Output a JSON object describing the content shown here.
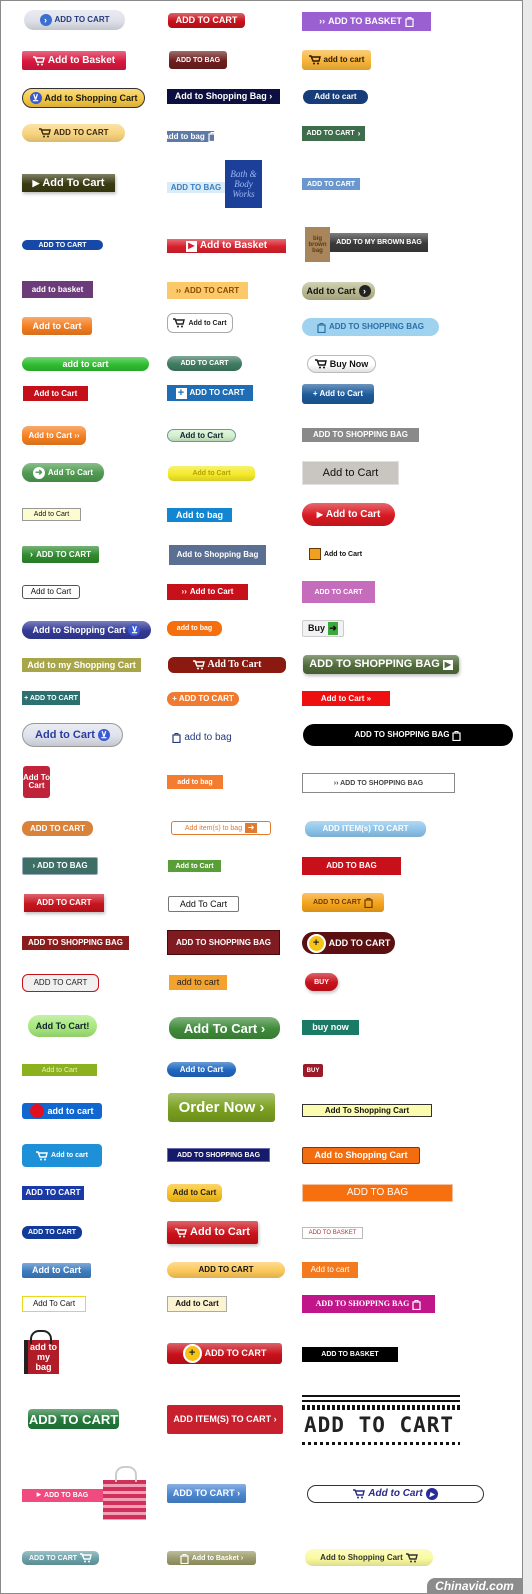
{
  "buttons": [
    {
      "label": "ADD TO CART",
      "bg": "#dfe0ea",
      "fg": "#233a7a",
      "icon": "chevron-circle",
      "icolor": "#3a6ed0"
    },
    {
      "label": "ADD TO CART",
      "bg": "#c8101a",
      "fg": "#ffffff"
    },
    {
      "label": "ADD TO BASKET",
      "bg": "#9a5fd0",
      "fg": "#ffffff",
      "icon": "double-chevron",
      "icon2": "basket"
    },
    {
      "label": "Add to Basket",
      "bg": "#d8173f",
      "fg": "#ffffff",
      "icon": "cart"
    },
    {
      "label": "ADD TO BAG",
      "bg": "#6e1e1e",
      "fg": "#ffffff"
    },
    {
      "label": "add to cart",
      "bg": "#f7b43a",
      "fg": "#2a1a00",
      "icon": "cart"
    },
    {
      "label": "Add to Shopping Cart",
      "bg": "#f5c842",
      "fg": "#1a1a1a",
      "icon": "cart-circle",
      "border": "#333333"
    },
    {
      "label": "Add to Shopping Bag ›",
      "bg": "#0c0f40",
      "fg": "#ffffff"
    },
    {
      "label": "Add to cart",
      "bg": "#163d7a",
      "fg": "#ffffff"
    },
    {
      "label": "ADD TO CART",
      "bg": "#f8d37c",
      "fg": "#3a2a10",
      "icon": "cart"
    },
    {
      "label": "add to bag",
      "bg": "#5e79a5",
      "fg": "#ffffff",
      "icon2": "bag"
    },
    {
      "label": "ADD TO CART",
      "bg": "#3d6d4a",
      "fg": "#ffffff",
      "icon2": "chevron"
    },
    {
      "label": "Add To Cart",
      "bg": "#3b3b12",
      "fg": "#ffffff",
      "icon": "play"
    },
    {
      "label": "ADD TO BAG",
      "bg": "#d9ecf8",
      "fg": "#3b7fc0"
    },
    {
      "label": "ADD TO CART",
      "bg": "#6b97cf",
      "fg": "#ffffff"
    },
    {
      "label": "ADD TO CART",
      "bg": "#1648a8",
      "fg": "#ffffff"
    },
    {
      "label": "Add to Basket",
      "bg": "#d8202c",
      "fg": "#ffffff",
      "icon": "play-box"
    },
    {
      "label": "ADD TO MY BROWN BAG",
      "bg": "#3a3a3a",
      "fg": "#ffffff"
    },
    {
      "label": "add to basket",
      "bg": "#6b3b7a",
      "fg": "#ffffff"
    },
    {
      "label": "ADD TO CART",
      "bg": "#fcc96a",
      "fg": "#8a4a00",
      "icon": "double-chevron"
    },
    {
      "label": "Add to Cart",
      "bg": "#b8b890",
      "fg": "#111111",
      "icon2": "chevron-circle",
      "icolor": "#222222"
    },
    {
      "label": "Add to Cart",
      "bg": "#f47d20",
      "fg": "#ffffff"
    },
    {
      "label": "Add to Cart",
      "bg": "#ffffff",
      "fg": "#222222",
      "icon": "cart",
      "border": "#aaaaaa"
    },
    {
      "label": "ADD TO SHOPPING BAG",
      "bg": "#9fd2ef",
      "fg": "#2a6fa8",
      "icon": "basket"
    },
    {
      "label": "add to cart",
      "bg": "#2fbd2f",
      "fg": "#ffffff"
    },
    {
      "label": "ADD TO CART",
      "bg": "#3f7a60",
      "fg": "#ffffff"
    },
    {
      "label": "Buy Now",
      "bg": "#ffffff",
      "fg": "#111111",
      "icon": "cart",
      "border": "#bbbbbb"
    },
    {
      "label": "Add to Cart",
      "bg": "#c3101a",
      "fg": "#ffffff"
    },
    {
      "label": "ADD TO CART",
      "bg": "#1f6eb5",
      "fg": "#ffffff",
      "icon": "plus-box"
    },
    {
      "label": "+ Add to Cart",
      "bg": "#1c5a9a",
      "fg": "#ffffff"
    },
    {
      "label": "Add to Cart ››",
      "bg": "#f57f1f",
      "fg": "#ffffff"
    },
    {
      "label": "Add to Cart",
      "bg": "#d2f0cc",
      "fg": "#112233",
      "border": "#6a9a9a"
    },
    {
      "label": "ADD TO SHOPPING BAG",
      "bg": "#8a8a8a",
      "fg": "#ffffff"
    },
    {
      "label": "Add To Cart",
      "bg": "#4e9a50",
      "fg": "#ffffff",
      "icon": "arrow-circle"
    },
    {
      "label": "Add to Cart",
      "bg": "#f4ea28",
      "fg": "#b7a000"
    },
    {
      "label": "Add to Cart",
      "bg": "#c9c5c0",
      "fg": "#111111",
      "border": "#e0e0e0"
    },
    {
      "label": "Add to Cart",
      "bg": "#fdfbd0",
      "fg": "#111111",
      "border": "#999999"
    },
    {
      "label": "Add to bag",
      "bg": "#1286d0",
      "fg": "#ffffff"
    },
    {
      "label": "Add to Cart",
      "bg": "#d81820",
      "fg": "#ffffff",
      "icon": "play"
    },
    {
      "label": "ADD TO CART",
      "bg": "#2e8a2e",
      "fg": "#ffffff",
      "icon": "chevron"
    },
    {
      "label": "Add to Shopping Bag",
      "bg": "#5b6f92",
      "fg": "#ffffff"
    },
    {
      "label": "Add to Cart",
      "bg": "#ffffff",
      "fg": "#111111",
      "icon": "orange-box"
    },
    {
      "label": "Add to Cart",
      "bg": "#ffffff",
      "fg": "#111111",
      "border": "#555555"
    },
    {
      "label": "Add to Cart",
      "bg": "#c8101a",
      "fg": "#ffffff",
      "icon": "double-chevron"
    },
    {
      "label": "ADD TO CART",
      "bg": "#c66cbc",
      "fg": "#ffffff"
    },
    {
      "label": "Add to Shopping Cart",
      "bg": "#333a96",
      "fg": "#ffffff",
      "icon2": "cart-circle"
    },
    {
      "label": "add to bag",
      "bg": "#f66f0e",
      "fg": "#ffffff"
    },
    {
      "label": "Buy",
      "bg": "#f2f2f2",
      "fg": "#111111",
      "icon2": "green-arrow",
      "border": "#cccccc"
    },
    {
      "label": "Add to my Shopping Cart",
      "bg": "#a9a54a",
      "fg": "#ffffff"
    },
    {
      "label": "Add To Cart",
      "bg": "#8a1a10",
      "fg": "#ffffff",
      "icon": "cart"
    },
    {
      "label": "ADD TO SHOPPING BAG",
      "bg": "#506b39",
      "fg": "#ffffff",
      "icon2": "square-arrow"
    },
    {
      "label": "+ ADD TO CART",
      "bg": "#2c7070",
      "fg": "#ffffff"
    },
    {
      "label": "+ ADD TO CART",
      "bg": "#f07a30",
      "fg": "#ffffff"
    },
    {
      "label": "Add to Cart »",
      "bg": "#ee1010",
      "fg": "#ffffff"
    },
    {
      "label": "Add to Cart",
      "bg": "#dfe2ec",
      "fg": "#2a3c9e",
      "icon2": "cart-circle",
      "border": "#999999"
    },
    {
      "label": "add to bag",
      "bg": "#ffffff",
      "fg": "#233a7a",
      "icon": "bag"
    },
    {
      "label": "ADD TO SHOPPING BAG",
      "bg": "#000000",
      "fg": "#ffffff",
      "icon2": "bag"
    },
    {
      "label": "Add To Cart",
      "bg": "#c0243a",
      "fg": "#ffffff"
    },
    {
      "label": "add to bag",
      "bg": "#f47c30",
      "fg": "#ffffff"
    },
    {
      "label": "›› ADD TO SHOPPING BAG",
      "bg": "#ffffff",
      "fg": "#444444",
      "border": "#888888"
    },
    {
      "label": "ADD TO CART",
      "bg": "#d9823a",
      "fg": "#ffffff"
    },
    {
      "label": "Add item(s) to bag",
      "bg": "#ffffff",
      "fg": "#e07a30",
      "icon2": "arrow-box",
      "border": "#e07a30"
    },
    {
      "label": "ADD ITEM(s) TO CART",
      "bg": "#8cc4ea",
      "fg": "#ffffff"
    },
    {
      "label": "› ADD TO BAG",
      "bg": "#3d6f66",
      "fg": "#ffffff",
      "border": "#9ab"
    },
    {
      "label": "Add to Cart",
      "bg": "#5a9e3a",
      "fg": "#ffffff"
    },
    {
      "label": "ADD TO BAG",
      "bg": "#c8101a",
      "fg": "#ffffff"
    },
    {
      "label": "ADD TO CART",
      "bg": "#c8141e",
      "fg": "#ffffff"
    },
    {
      "label": "Add To Cart",
      "bg": "#ffffff",
      "fg": "#111111",
      "border": "#777777"
    },
    {
      "label": "ADD TO CART",
      "bg": "#f5a31a",
      "fg": "#6a3a00",
      "icon2": "basket"
    },
    {
      "label": "ADD TO SHOPPING BAG",
      "bg": "#8a1c1c",
      "fg": "#ffffff"
    },
    {
      "label": "ADD TO SHOPPING BAG",
      "bg": "#7f1c22",
      "fg": "#ffffff",
      "border": "#4a0a0a"
    },
    {
      "label": "ADD TO CART",
      "bg": "#5a0f10",
      "fg": "#ffffff",
      "icon": "plus-circle"
    },
    {
      "label": "ADD TO CART",
      "bg": "#f0f0f0",
      "fg": "#222222",
      "border": "#c8101a"
    },
    {
      "label": "add to cart",
      "bg": "#f3a22e",
      "fg": "#222222"
    },
    {
      "label": "BUY",
      "bg": "#c8101a",
      "fg": "#ffffff"
    },
    {
      "label": "Add To Cart!",
      "bg": "#a6e87a",
      "fg": "#112233"
    },
    {
      "label": "Add To Cart ›",
      "bg": "#3f8a3a",
      "fg": "#ffffff"
    },
    {
      "label": "buy now",
      "bg": "#1a7a66",
      "fg": "#ffffff"
    },
    {
      "label": "Add to Cart",
      "bg": "#8bb11e",
      "fg": "#eaf3c0"
    },
    {
      "label": "Add to Cart",
      "bg": "#1e66c0",
      "fg": "#ffffff"
    },
    {
      "label": "BUY",
      "bg": "#9a1a2a",
      "fg": "#ffffff"
    },
    {
      "label": "add to cart",
      "bg": "#1266d0",
      "fg": "#ffffff",
      "icon": "red-dot"
    },
    {
      "label": "Order Now ›",
      "bg": "#7aa020",
      "fg": "#ffffff"
    },
    {
      "label": "Add To Shopping Cart",
      "bg": "#fcfcb0",
      "fg": "#111111",
      "border": "#333333"
    },
    {
      "label": "Add to cart",
      "bg": "#1e90d8",
      "fg": "#ffffff",
      "icon": "cart"
    },
    {
      "label": "ADD TO SHOPPING BAG",
      "bg": "#161a6a",
      "fg": "#ffffff",
      "border": "#6a6ab0"
    },
    {
      "label": "Add to Shopping Cart",
      "bg": "#f26c10",
      "fg": "#ffffff",
      "border": "#7a3a10"
    },
    {
      "label": "ADD TO CART",
      "bg": "#1a3aa8",
      "fg": "#ffffff"
    },
    {
      "label": "Add to Cart",
      "bg": "#f8c020",
      "fg": "#222222"
    },
    {
      "label": "ADD TO BAG",
      "bg": "#f77010",
      "fg": "#ffffff",
      "border": "#f0c0a0"
    },
    {
      "label": "ADD TO CART",
      "bg": "#123a98",
      "fg": "#ffffff"
    },
    {
      "label": "Add to Cart",
      "bg": "#cc1018",
      "fg": "#ffffff",
      "icon": "cart"
    },
    {
      "label": "ADD TO BASKET",
      "bg": "#ffffff",
      "fg": "#b03030",
      "border": "#bbbbbb"
    },
    {
      "label": "Add to Cart",
      "bg": "#3d7cc0",
      "fg": "#ffffff"
    },
    {
      "label": "ADD TO CART",
      "bg": "#fcc85a",
      "fg": "#111111"
    },
    {
      "label": "Add to cart",
      "bg": "#f47a20",
      "fg": "#ffffff"
    },
    {
      "label": "Add To Cart",
      "bg": "#ffffff",
      "fg": "#111111",
      "border": "#e8d820"
    },
    {
      "label": "Add to Cart",
      "bg": "#fcf4d0",
      "fg": "#111111",
      "border": "#aaaaaa"
    },
    {
      "label": "ADD TO SHOPPING BAG",
      "bg": "#c0168a",
      "fg": "#ffffff",
      "icon2": "bag"
    },
    {
      "label": "ADD TO CART",
      "bg": "#c8101a",
      "fg": "#ffffff",
      "icon": "plus-circle"
    },
    {
      "label": "ADD TO BASKET",
      "bg": "#000000",
      "fg": "#ffffff"
    },
    {
      "label": "ADD TO CART",
      "bg": "#237a3a",
      "fg": "#ffffff"
    },
    {
      "label": "ADD ITEM(S) TO CART ›",
      "bg": "#c8202e",
      "fg": "#ffffff"
    },
    {
      "label": "ADD TO BAG",
      "bg": "#f04a80",
      "fg": "#ffffff",
      "icon": "play"
    },
    {
      "label": "ADD TO CART ›",
      "bg": "#4a86d0",
      "fg": "#ffffff"
    },
    {
      "label": "Add to Cart",
      "bg": "#ffffff",
      "fg": "#2a2a8a",
      "icon": "cart",
      "icon2": "play-circle",
      "border": "#333333"
    },
    {
      "label": "ADD TO CART",
      "bg": "#6aa0a8",
      "fg": "#ffffff",
      "icon2": "cart"
    },
    {
      "label": "Add to Basket ›",
      "bg": "#9a9a6a",
      "fg": "#ffffff",
      "icon": "basket"
    },
    {
      "label": "Add to Shopping Cart",
      "bg": "#fafaa0",
      "fg": "#333333",
      "icon2": "cart"
    }
  ],
  "images": {
    "bath_bag_logo": "Bath & Body Works",
    "brown_bag_logo": "big brown bag",
    "my_bag_label": "add to my bag",
    "stamp_label": "ADD TO CART"
  },
  "watermark": "Chinavid.com"
}
